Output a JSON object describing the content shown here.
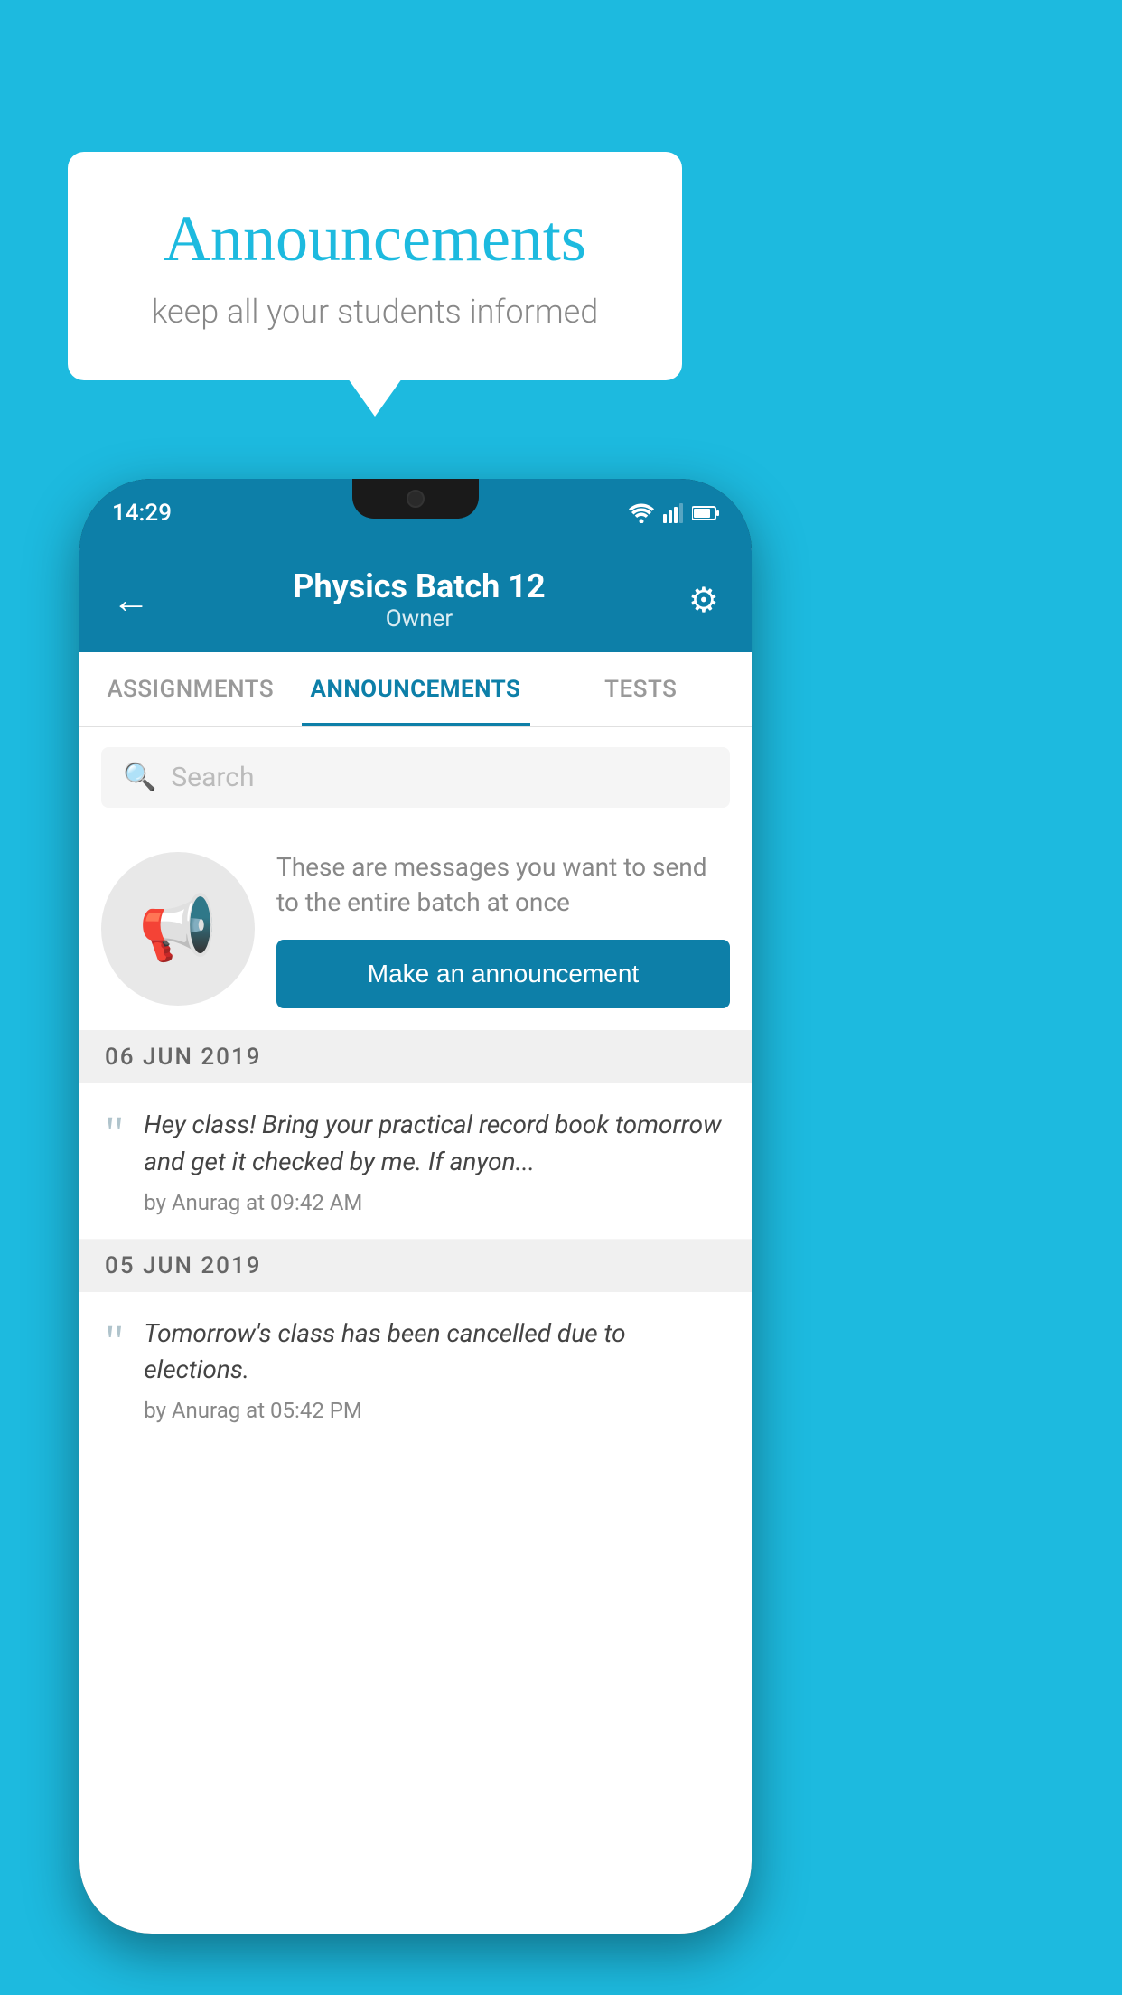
{
  "background_color": "#1DBADF",
  "speech_bubble": {
    "title": "Announcements",
    "subtitle": "keep all your students informed"
  },
  "phone": {
    "status_bar": {
      "time": "14:29"
    },
    "header": {
      "back_label": "←",
      "title": "Physics Batch 12",
      "subtitle": "Owner",
      "gear_label": "⚙"
    },
    "tabs": [
      {
        "label": "ASSIGNMENTS",
        "active": false
      },
      {
        "label": "ANNOUNCEMENTS",
        "active": true
      },
      {
        "label": "TESTS",
        "active": false
      }
    ],
    "search": {
      "placeholder": "Search"
    },
    "cta": {
      "description": "These are messages you want to send to the entire batch at once",
      "button_label": "Make an announcement"
    },
    "announcements": [
      {
        "date": "06  JUN  2019",
        "messages": [
          {
            "text": "Hey class! Bring your practical record book tomorrow and get it checked by me. If anyon...",
            "meta": "by Anurag at 09:42 AM"
          }
        ]
      },
      {
        "date": "05  JUN  2019",
        "messages": [
          {
            "text": "Tomorrow's class has been cancelled due to elections.",
            "meta": "by Anurag at 05:42 PM"
          }
        ]
      }
    ]
  }
}
